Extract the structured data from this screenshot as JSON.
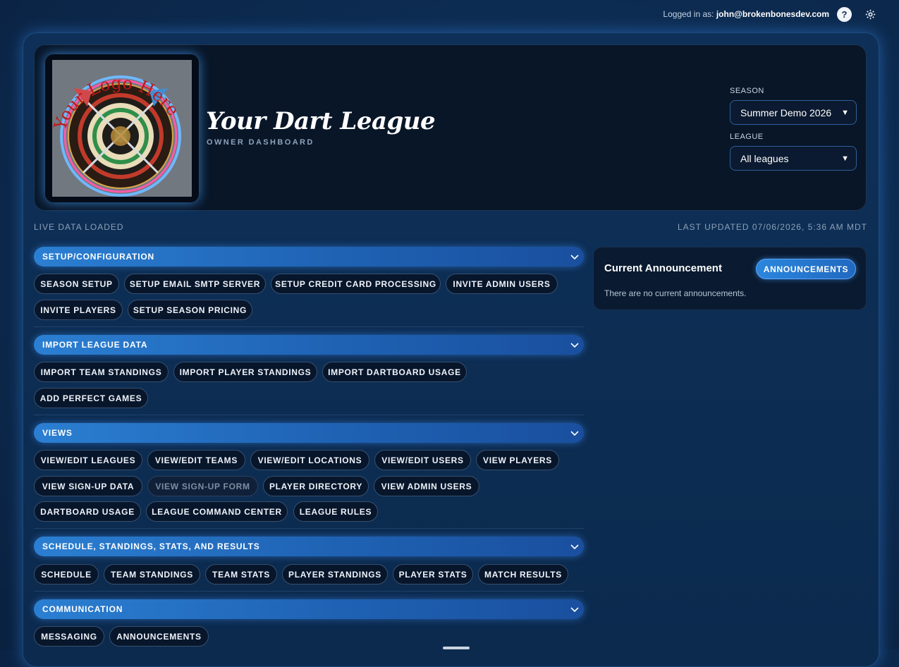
{
  "topbar": {
    "logged_in_label": "Logged in as:",
    "user_email": "john@brokenbonesdev.com",
    "help_glyph": "?",
    "help_icon": "help-icon",
    "gear_icon": "gear-icon"
  },
  "header": {
    "logo_text": "Your Logo Here",
    "logo_icon": "dartboard-logo",
    "league_name": "Your Dart League",
    "subtitle": "OWNER DASHBOARD",
    "season_label": "SEASON",
    "season_value": "Summer Demo 2026",
    "league_label": "LEAGUE",
    "league_value": "All leagues"
  },
  "status": {
    "left": "LIVE DATA LOADED",
    "right": "LAST UPDATED 07/06/2026, 5:36 AM MDT"
  },
  "sections": [
    {
      "title": "SETUP/CONFIGURATION",
      "buttons": [
        "SEASON SETUP",
        "SETUP EMAIL SMTP SERVER",
        "SETUP CREDIT CARD PROCESSING",
        "INVITE ADMIN USERS",
        "INVITE PLAYERS",
        "SETUP SEASON PRICING"
      ]
    },
    {
      "title": "IMPORT LEAGUE DATA",
      "buttons": [
        "IMPORT TEAM STANDINGS",
        "IMPORT PLAYER STANDINGS",
        "IMPORT DARTBOARD USAGE",
        "ADD PERFECT GAMES"
      ]
    },
    {
      "title": "VIEWS",
      "buttons": [
        "VIEW/EDIT LEAGUES",
        "VIEW/EDIT TEAMS",
        "VIEW/EDIT LOCATIONS",
        "VIEW/EDIT USERS",
        "VIEW PLAYERS",
        "VIEW SIGN-UP DATA",
        "VIEW SIGN-UP FORM",
        "PLAYER DIRECTORY",
        "VIEW ADMIN USERS",
        "DARTBOARD USAGE",
        "LEAGUE COMMAND CENTER",
        "LEAGUE RULES"
      ]
    },
    {
      "title": "SCHEDULE, STANDINGS, STATS, AND RESULTS",
      "buttons": [
        "SCHEDULE",
        "TEAM STANDINGS",
        "TEAM STATS",
        "PLAYER STANDINGS",
        "PLAYER STATS",
        "MATCH RESULTS"
      ]
    },
    {
      "title": "COMMUNICATION",
      "buttons": [
        "MESSAGING",
        "ANNOUNCEMENTS"
      ]
    }
  ],
  "announcement": {
    "title": "Current Announcement",
    "button": "ANNOUNCEMENTS",
    "empty_text": "There are no current announcements."
  },
  "colors": {
    "accent": "#2b7fd2",
    "background": "#0d2c52",
    "card": "#081628",
    "disabled_text": "#7d8ea3"
  }
}
